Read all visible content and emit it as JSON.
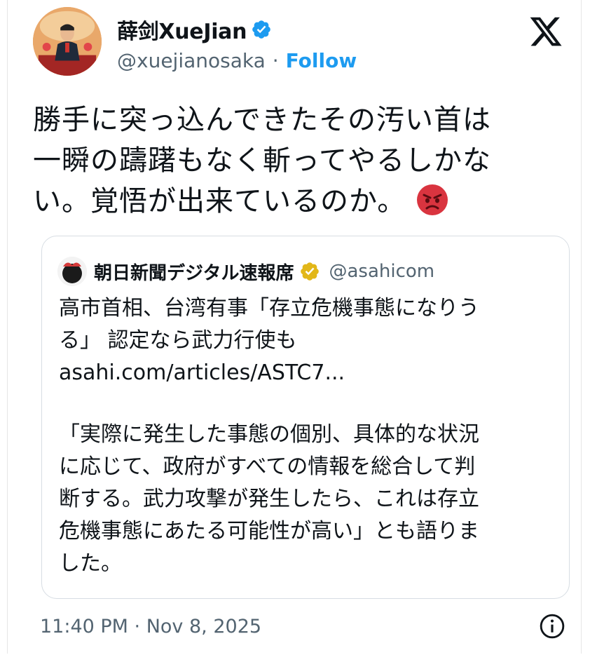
{
  "author": {
    "display_name": "薛剑XueJian",
    "handle": "@xuejianosaka",
    "separator": "·",
    "follow_label": "Follow",
    "verified_icon": "verified-badge-icon",
    "verified_color": "#1d9bf0"
  },
  "tweet": {
    "lines": [
      "勝手に突っ込んできたその汚い首は",
      "一瞬の躊躇もなく斬ってやるしかな",
      "い。覚悟が出来ているのか。"
    ],
    "emoji": "angry-face-icon"
  },
  "quoted": {
    "display_name": "朝日新聞デジタル速報席",
    "handle": "@asahicom",
    "badge_icon": "gold-verified-badge-icon",
    "badge_color": "#e2b719",
    "headline_lines": [
      "高市首相、台湾有事「存立危機事態になりう",
      "る」 認定なら武力行使も"
    ],
    "link": "asahi.com/articles/ASTC7...",
    "quote_lines": [
      "「実際に発生した事態の個別、具体的な状況",
      "に応じて、政府がすべての情報を総合して判",
      "断する。武力攻撃が発生したら、これは存立",
      "危機事態にあたる可能性が高い」とも語りま",
      "した。"
    ]
  },
  "footer": {
    "timestamp": "11:40 PM · Nov 8, 2025",
    "info_icon": "info-icon"
  },
  "colors": {
    "accent": "#1d9bf0",
    "text": "#0f1419",
    "secondary": "#536471",
    "border": "#d7dde3"
  }
}
